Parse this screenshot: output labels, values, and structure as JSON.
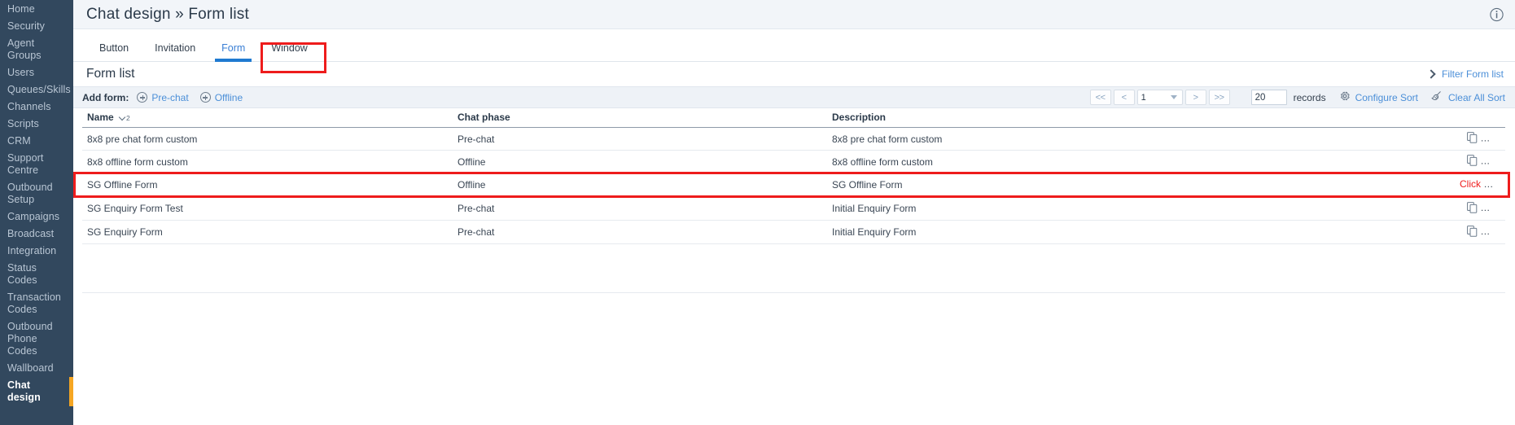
{
  "sidebar": {
    "items": [
      {
        "label": "Home",
        "active": false
      },
      {
        "label": "Security",
        "active": false
      },
      {
        "label": "Agent Groups",
        "active": false
      },
      {
        "label": "Users",
        "active": false
      },
      {
        "label": "Queues/Skills",
        "active": false
      },
      {
        "label": "Channels",
        "active": false
      },
      {
        "label": "Scripts",
        "active": false
      },
      {
        "label": "CRM",
        "active": false
      },
      {
        "label": "Support Centre",
        "active": false
      },
      {
        "label": "Outbound Setup",
        "active": false
      },
      {
        "label": "Campaigns",
        "active": false
      },
      {
        "label": "Broadcast",
        "active": false
      },
      {
        "label": "Integration",
        "active": false
      },
      {
        "label": "Status Codes",
        "active": false
      },
      {
        "label": "Transaction Codes",
        "active": false
      },
      {
        "label": "Outbound Phone Codes",
        "active": false
      },
      {
        "label": "Wallboard",
        "active": false
      },
      {
        "label": "Chat design",
        "active": true
      }
    ]
  },
  "header": {
    "breadcrumb": "Chat design » Form list",
    "info_icon": "info-circle-icon"
  },
  "tabs": [
    {
      "label": "Button",
      "active": false
    },
    {
      "label": "Invitation",
      "active": false
    },
    {
      "label": "Form",
      "active": true
    },
    {
      "label": "Window",
      "active": false
    }
  ],
  "section": {
    "title": "Form list",
    "filter_link": "Filter Form list",
    "filter_chevron_icon": "chevron-right-icon"
  },
  "toolbar": {
    "add_form_label": "Add form:",
    "add_prechat": "Pre-chat",
    "add_offline": "Offline",
    "add_icon": "plus-circle-icon",
    "pager": {
      "first": "<<",
      "prev": "<",
      "page_value": "1",
      "next": ">",
      "last": ">>"
    },
    "records_value": "20",
    "records_label": "records",
    "configure_sort": "Configure Sort",
    "configure_sort_icon": "gear-icon",
    "clear_all_sort": "Clear All Sort",
    "clear_all_sort_icon": "broom-icon"
  },
  "table": {
    "columns": [
      {
        "label": "Name",
        "sorted": true,
        "sort_index": "2",
        "sort_icon": "sort-descending-icon"
      },
      {
        "label": "Chat phase",
        "sorted": false
      },
      {
        "label": "Description",
        "sorted": false
      }
    ],
    "rows": [
      {
        "name": "8x8 pre chat form custom",
        "phase": "Pre-chat",
        "description": "8x8 pre chat form custom",
        "annotation": "",
        "icons": [
          "copy-icon",
          "eye-icon"
        ],
        "highlighted": false
      },
      {
        "name": "8x8 offline form custom",
        "phase": "Offline",
        "description": "8x8 offline form custom",
        "annotation": "",
        "icons": [
          "copy-icon",
          "eye-icon"
        ],
        "highlighted": false
      },
      {
        "name": "SG Offline Form",
        "phase": "Offline",
        "description": "SG Offline Form",
        "annotation": "Click on penci to add personalise message",
        "icons": [
          "copy-icon",
          "pencil-icon"
        ],
        "highlighted": true
      },
      {
        "name": "SG Enquiry Form Test",
        "phase": "Pre-chat",
        "description": "Initial Enquiry Form",
        "annotation": "",
        "icons": [
          "copy-icon",
          "pencil-icon"
        ],
        "highlighted": false
      },
      {
        "name": "SG Enquiry Form",
        "phase": "Pre-chat",
        "description": "Initial Enquiry Form",
        "annotation": "",
        "icons": [
          "copy-icon",
          "pencil-icon"
        ],
        "highlighted": false
      }
    ]
  },
  "colors": {
    "sidebar_bg": "#32485e",
    "sidebar_active_accent": "#f5a623",
    "tab_active": "#1f7ad1",
    "link": "#4b8fd8",
    "annotation_red": "#ee1c1c",
    "header_bg": "#f2f5f9",
    "toolbar_bg": "#eef2f7"
  }
}
